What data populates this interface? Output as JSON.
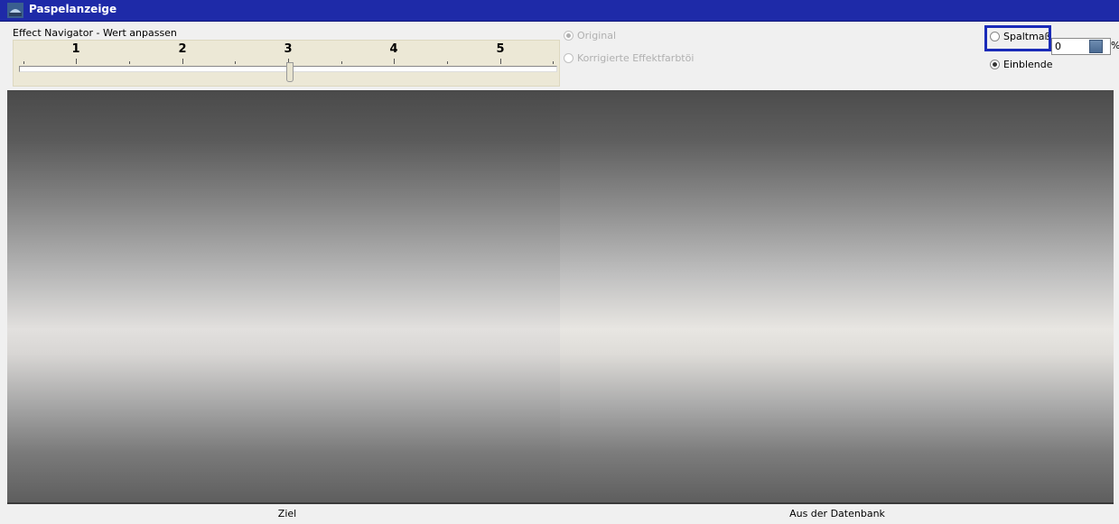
{
  "window": {
    "title": "Paspelanzeige"
  },
  "navigator": {
    "label": "Effect Navigator - Wert anpassen",
    "ticks": [
      "1",
      "2",
      "3",
      "4",
      "5"
    ],
    "value": 3
  },
  "view_options": {
    "original": {
      "label": "Original",
      "checked": true,
      "enabled": false
    },
    "corrected": {
      "label": "Korrigierte Effektfarbtöi",
      "checked": false,
      "enabled": false
    }
  },
  "display_options": {
    "gap": {
      "label": "Spaltmaß",
      "checked": false
    },
    "fade": {
      "label": "Einblende",
      "checked": true
    }
  },
  "percent_field": {
    "value": "0",
    "unit": "%"
  },
  "preview": {
    "left_label": "Ziel",
    "right_label": "Aus der Datenbank"
  }
}
